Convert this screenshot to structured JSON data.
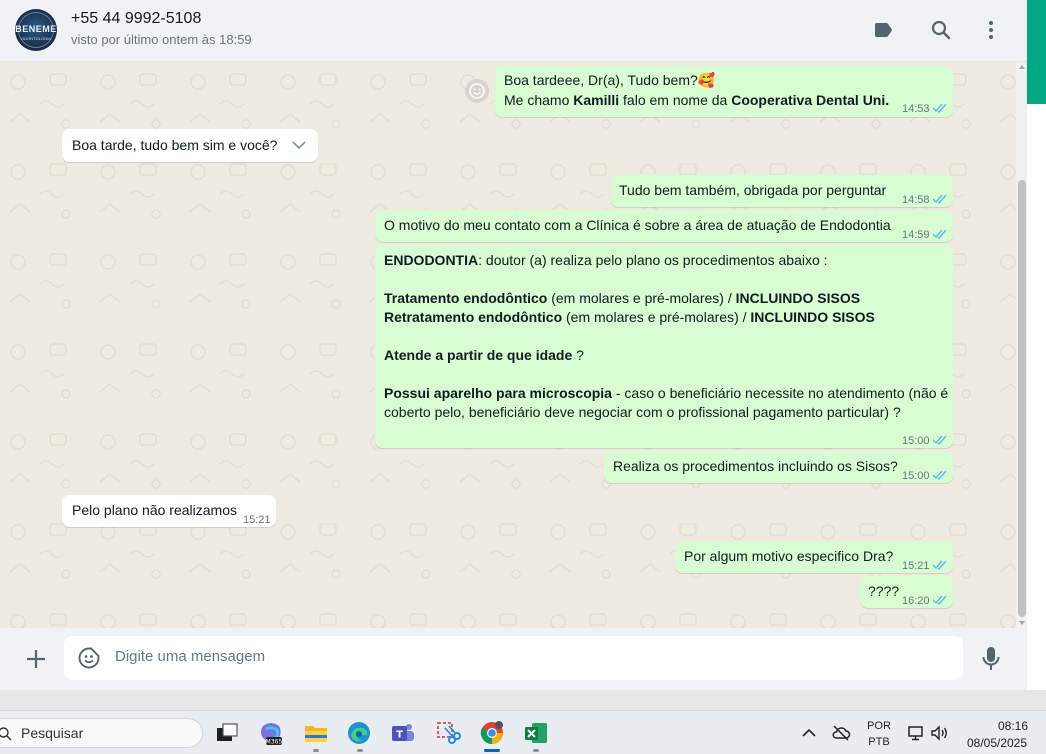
{
  "header": {
    "contact_name": "+55 44 9992-5108",
    "status": "visto por último ontem às 18:59",
    "avatar_text": "BENEME",
    "avatar_subtext": "ODONTOLOGIA",
    "icons": [
      "label-icon",
      "search-icon",
      "menu-kebab-icon"
    ]
  },
  "messages": [
    {
      "dir": "out",
      "lines": [
        "Boa tardeee, Dr(a), Tudo bem?🥰",
        "Me chamo Kamilli falo em nome da Cooperativa Dental Uni."
      ],
      "time": "14:53",
      "read": true
    },
    {
      "dir": "in",
      "text": "Boa tarde, tudo bem sim e você?",
      "time": ""
    },
    {
      "dir": "out",
      "text": "Tudo bem também, obrigada por perguntar",
      "time": "14:58",
      "read": true
    },
    {
      "dir": "out",
      "text": "O motivo do meu contato com a Clínica é sobre a área de atuação de Endodontia",
      "time": "14:59",
      "read": true
    },
    {
      "dir": "out",
      "time": "15:00",
      "read": true,
      "l1_bold": "ENDODONTIA",
      "l1_rest": ":  doutor (a) realiza pelo plano os procedimentos abaixo :",
      "l2_bold": "Tratamento endodôntico",
      "l2_mid": " (em molares e pré-molares) / ",
      "l2_bold2": "INCLUINDO SISOS",
      "l3_bold": "Retratamento endodôntico",
      "l3_mid": " (em molares e pré-molares) / ",
      "l3_bold2": "INCLUINDO SISOS",
      "l4_bold": "Atende a partir de que idade",
      "l4_rest": "  ?",
      "l5_bold": "Possui aparelho para microscopia",
      "l5_rest": " - caso o beneficiário necessite no atendimento (não é",
      "l6": "coberto pelo, beneficiário deve negociar com o profissional pagamento particular)  ?"
    },
    {
      "dir": "out",
      "text": "Realiza os procedimentos incluindo os Sisos?",
      "time": "15:00",
      "read": true
    },
    {
      "dir": "in",
      "text": "Pelo plano não realizamos",
      "time": "15:21"
    },
    {
      "dir": "out",
      "text": "Por algum motivo especifico Dra?",
      "time": "15:21",
      "read": true
    },
    {
      "dir": "out",
      "text": "????",
      "time": "16:20",
      "read": true
    }
  ],
  "composer": {
    "placeholder": "Digite uma mensagem",
    "icons": [
      "plus-icon",
      "sticker-icon",
      "microphone-icon"
    ]
  },
  "taskbar": {
    "search_label": "Pesquisar",
    "apps": [
      "task-view",
      "microsoft-365",
      "file-explorer",
      "edge",
      "teams",
      "snipping-tool",
      "chrome",
      "excel"
    ],
    "tray": {
      "lang_top": "POR",
      "lang_bottom": "PTB",
      "time": "08:16",
      "date": "08/05/2025"
    }
  },
  "colors": {
    "outgoing": "#d9fdd3",
    "incoming": "#ffffff",
    "accent": "#00a884",
    "tick_read": "#53bdeb"
  }
}
